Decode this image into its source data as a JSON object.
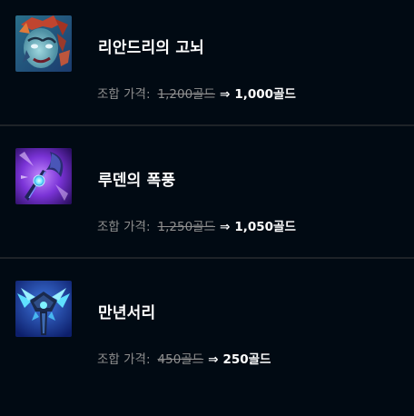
{
  "items": [
    {
      "name": "리안드리의 고뇌",
      "price_label": "조합 가격:",
      "old_price": "1,200골드",
      "arrow": "⇒",
      "new_price": "1,000골드",
      "icon": "liandrys-anguish-icon"
    },
    {
      "name": "루덴의 폭풍",
      "price_label": "조합 가격:",
      "old_price": "1,250골드",
      "arrow": "⇒",
      "new_price": "1,050골드",
      "icon": "ludens-tempest-icon"
    },
    {
      "name": "만년서리",
      "price_label": "조합 가격:",
      "old_price": "450골드",
      "arrow": "⇒",
      "new_price": "250골드",
      "icon": "everfrost-icon"
    }
  ],
  "colors": {
    "background": "#010a13",
    "divider": "#1e2328",
    "muted_text": "#8f8f8f",
    "primary_text": "#ffffff"
  }
}
